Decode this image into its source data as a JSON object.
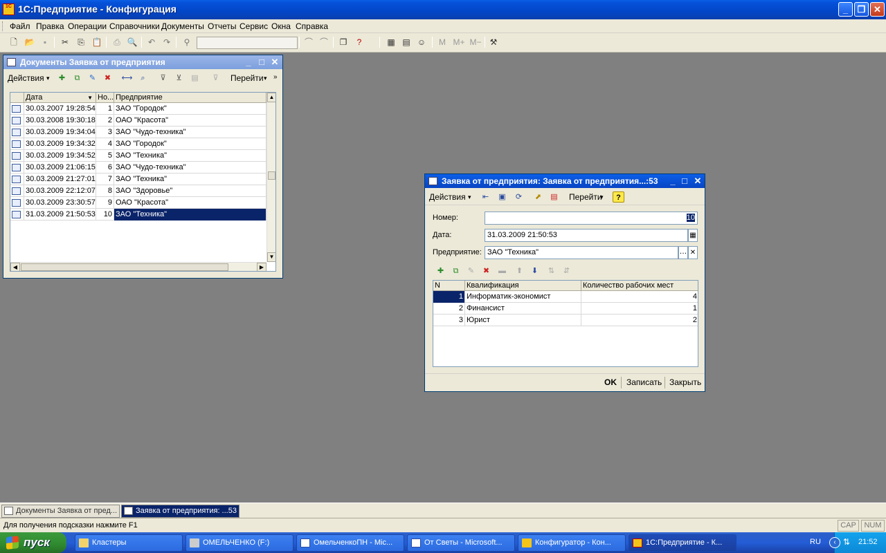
{
  "app": {
    "title": "1С:Предприятие - Конфигурация",
    "icon_text": "1C"
  },
  "menu": [
    "Файл",
    "Правка",
    "Операции",
    "Справочники",
    "Документы",
    "Отчеты",
    "Сервис",
    "Окна",
    "Справка"
  ],
  "toolbar_right": [
    "М",
    "М+",
    "М−"
  ],
  "list_window": {
    "title": "Документы Заявка от предприятия",
    "actions_label": "Действия",
    "goto_label": "Перейти",
    "headers": [
      "Дата",
      "Но...",
      "Предприятие"
    ],
    "rows": [
      {
        "date": "30.03.2007 19:28:54",
        "num": "1",
        "org": "ЗАО \"Городок\""
      },
      {
        "date": "30.03.2008 19:30:18",
        "num": "2",
        "org": "ОАО \"Красота\""
      },
      {
        "date": "30.03.2009 19:34:04",
        "num": "3",
        "org": "ЗАО \"Чудо-техника\""
      },
      {
        "date": "30.03.2009 19:34:32",
        "num": "4",
        "org": "ЗАО \"Городок\""
      },
      {
        "date": "30.03.2009 19:34:52",
        "num": "5",
        "org": "ЗАО \"Техника\""
      },
      {
        "date": "30.03.2009 21:06:15",
        "num": "6",
        "org": "ЗАО \"Чудо-техника\""
      },
      {
        "date": "30.03.2009 21:27:01",
        "num": "7",
        "org": "ЗАО \"Техника\""
      },
      {
        "date": "30.03.2009 22:12:07",
        "num": "8",
        "org": "ЗАО \"Здоровье\""
      },
      {
        "date": "30.03.2009 23:30:57",
        "num": "9",
        "org": "ОАО \"Красота\""
      },
      {
        "date": "31.03.2009 21:50:53",
        "num": "10",
        "org": "ЗАО \"Техника\""
      }
    ]
  },
  "doc_window": {
    "title": "Заявка от предприятия: Заявка от предприятия...:53",
    "actions_label": "Действия",
    "goto_label": "Перейти",
    "help_label": "?",
    "number_label": "Номер:",
    "number_value": "10",
    "date_label": "Дата:",
    "date_value": "31.03.2009 21:50:53",
    "org_label": "Предприятие:",
    "org_value": "ЗАО \"Техника\"",
    "headers": [
      "N",
      "Квалификация",
      "Количество рабочих мест"
    ],
    "rows": [
      {
        "n": "1",
        "q": "Информатик-экономист",
        "count": "4"
      },
      {
        "n": "2",
        "q": "Финансист",
        "count": "1"
      },
      {
        "n": "3",
        "q": "Юрист",
        "count": "2"
      }
    ],
    "ok_label": "OK",
    "save_label": "Записать",
    "close_label": "Закрыть"
  },
  "mdi_tasks": [
    "Документы Заявка от пред...",
    "Заявка от предприятия: ...53"
  ],
  "status": {
    "hint": "Для получения подсказки нажмите F1",
    "cap": "CAP",
    "num": "NUM"
  },
  "taskbar": {
    "start": "пуск",
    "items": [
      "Кластеры",
      "ОМЕЛЬЧЕНКО (F:)",
      "ОмельченкоПН - Mic...",
      "От Светы - Microsoft...",
      "Конфигуратор - Кон...",
      "1С:Предприятие - К..."
    ],
    "lang": "RU",
    "clock": "21:52"
  }
}
